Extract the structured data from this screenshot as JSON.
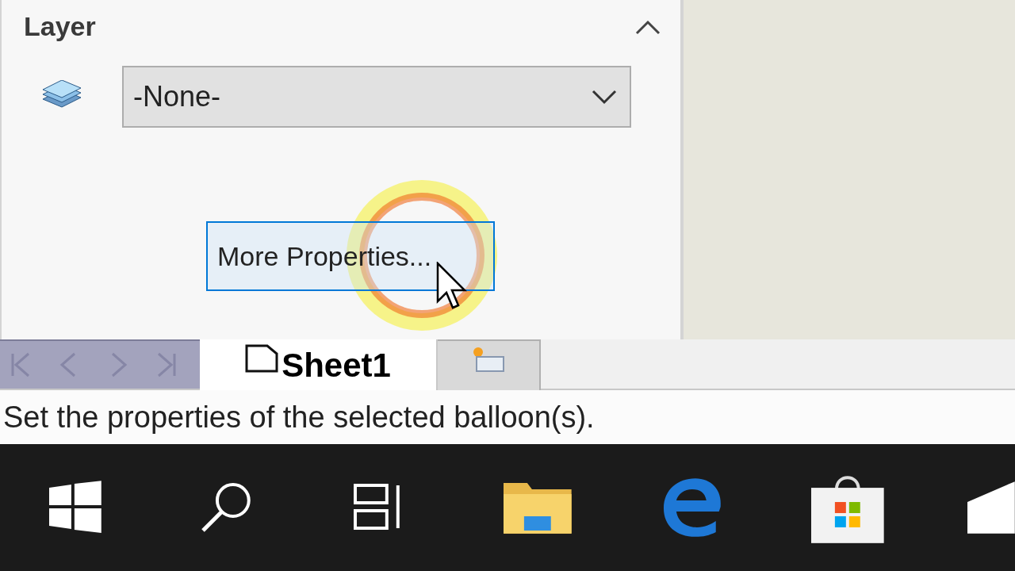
{
  "panel": {
    "section_title": "Layer",
    "expanded": true,
    "layer_dropdown": {
      "value": "-None-"
    },
    "more_button": "More Properties..."
  },
  "sheet_tabs": [
    {
      "kind": "sheet",
      "label": "Sheet1",
      "selected": true
    },
    {
      "kind": "add",
      "selected": false
    }
  ],
  "status_bar": "Set the properties of the selected balloon(s)."
}
